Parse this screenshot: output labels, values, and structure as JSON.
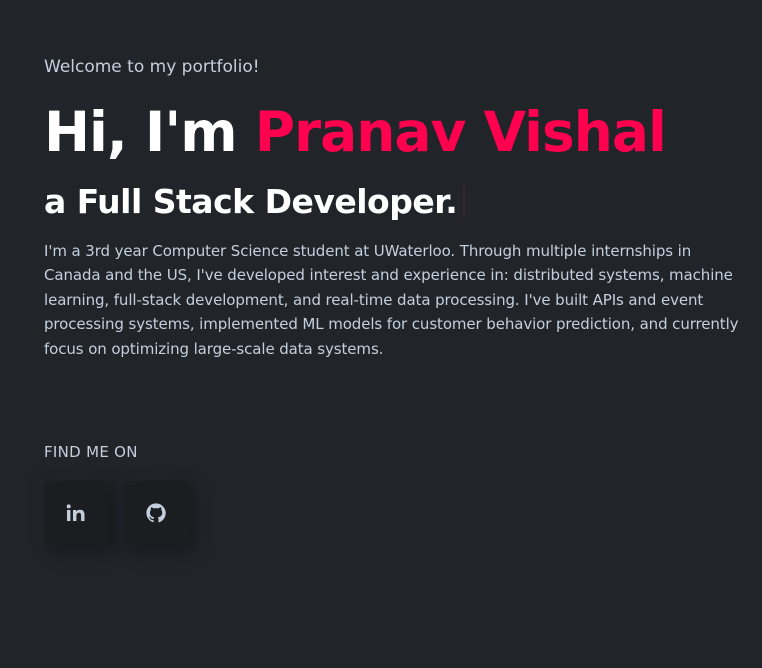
{
  "hero": {
    "welcome": "Welcome to my portfolio!",
    "greeting": "Hi, I'm ",
    "name": "Pranav Vishal",
    "role": "a Full Stack Developer.",
    "bio": "I'm a 3rd year Computer Science student at UWaterloo. Through multiple internships in Canada and the US, I've developed interest and experience in: distributed systems, machine learning, full-stack development, and real-time data processing. I've built APIs and event processing systems, implemented ML models for customer behavior prediction, and currently focus on optimizing large-scale data systems."
  },
  "social": {
    "heading": "FIND ME ON",
    "links": [
      {
        "icon": "linkedin-icon"
      },
      {
        "icon": "github-icon"
      }
    ]
  },
  "colors": {
    "background": "#212429",
    "accent": "#ff014f",
    "text": "#c4cfde",
    "heading": "#ffffff",
    "button": "#1b1d21"
  }
}
